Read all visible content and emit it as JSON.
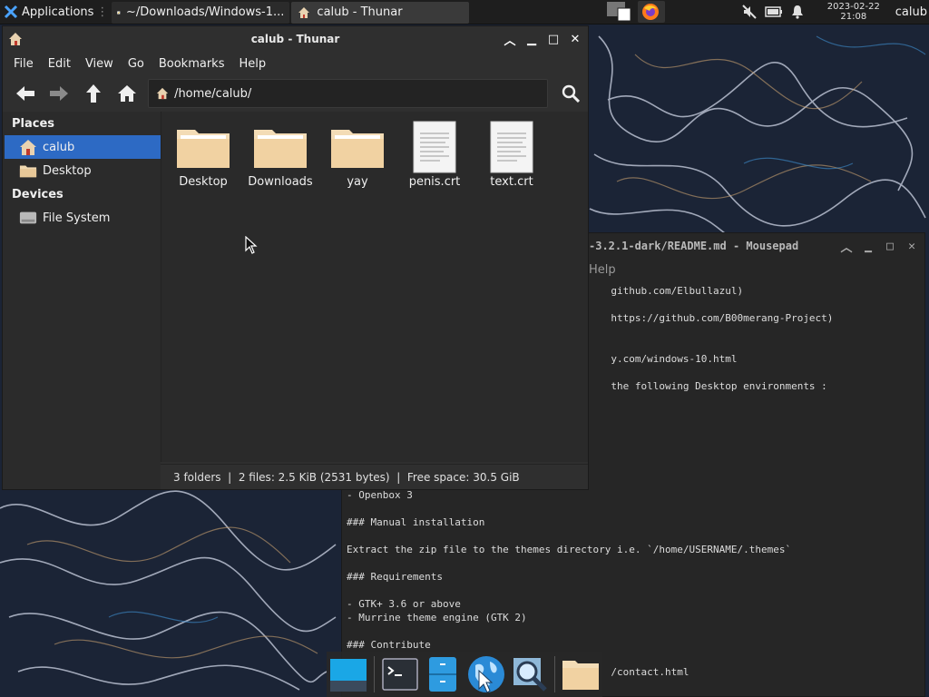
{
  "panel": {
    "applications": "Applications",
    "tasks": [
      {
        "label": "~/Downloads/Windows-1..."
      },
      {
        "label": "calub - Thunar"
      }
    ],
    "clock_date": "2023-02-22",
    "clock_time": "21:08",
    "user": "calub"
  },
  "thunar": {
    "title": "calub - Thunar",
    "menu": [
      "File",
      "Edit",
      "View",
      "Go",
      "Bookmarks",
      "Help"
    ],
    "path": "/home/calub/",
    "sidebar": {
      "places_header": "Places",
      "places": [
        "calub",
        "Desktop"
      ],
      "devices_header": "Devices",
      "devices": [
        "File System"
      ]
    },
    "files": [
      {
        "name": "Desktop",
        "type": "folder"
      },
      {
        "name": "Downloads",
        "type": "folder"
      },
      {
        "name": "yay",
        "type": "folder"
      },
      {
        "name": "penis.crt",
        "type": "file"
      },
      {
        "name": "text.crt",
        "type": "file"
      }
    ],
    "status": "3 folders  |  2 files: 2.5 KiB (2531 bytes)  |  Free space: 30.5 GiB"
  },
  "mousepad": {
    "title": "-3.2.1-dark/README.md - Mousepad",
    "menu_help": "Help",
    "lines": [
      "                                            github.com/Elbullazul)",
      "",
      "                                            https://github.com/B00merang-Project)",
      "",
      "",
      "                                            y.com/windows-10.html",
      "",
      "                                            the following Desktop environments :",
      "",
      "",
      "",
      "",
      "",
      "",
      "",
      "- Openbox 3",
      "",
      "### Manual installation",
      "",
      "Extract the zip file to the themes directory i.e. `/home/USERNAME/.themes`",
      "",
      "### Requirements",
      "",
      "- GTK+ 3.6 or above",
      "- Murrine theme engine (GTK 2)",
      "",
      "### Contribute",
      "",
      "                                            /contact.html"
    ]
  }
}
